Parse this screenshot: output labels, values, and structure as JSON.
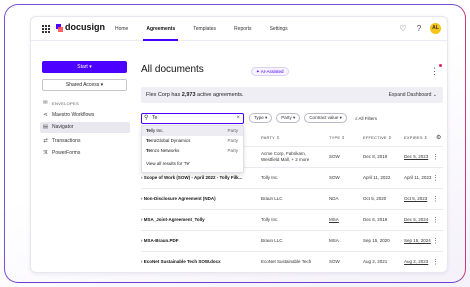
{
  "header": {
    "brand": "docusign",
    "nav": [
      "Home",
      "Agreements",
      "Templates",
      "Reports",
      "Settings"
    ],
    "active_nav": "Agreements",
    "avatar_initials": "AL"
  },
  "sidebar": {
    "start_label": "Start",
    "shared_access_label": "Shared Access",
    "items": [
      {
        "label": "ENVELOPES",
        "icon": "envelope-icon"
      },
      {
        "label": "Maestro Workflows",
        "icon": "workflow-icon"
      },
      {
        "label": "Navigator",
        "icon": "navigator-icon"
      },
      {
        "label": "Transactions",
        "icon": "transactions-icon"
      },
      {
        "label": "PowerForms",
        "icon": "powerforms-icon"
      }
    ]
  },
  "main": {
    "title": "All documents",
    "ai_badge": "AI-Assisted",
    "banner_prefix": "Flex Corp has ",
    "banner_count": "2,973",
    "banner_suffix": " active agreements.",
    "expand_label": "Expand Dashboard"
  },
  "search": {
    "value": "Te",
    "suggestions": [
      {
        "bold": "Te",
        "rest": "lly Inc.",
        "tag": "Party"
      },
      {
        "bold": "Te",
        "rest": "rraGlobal Dynamics",
        "tag": "Party"
      },
      {
        "bold": "Te",
        "rest": "Inzo Networks",
        "tag": "Party"
      }
    ],
    "view_all": "View all results for 'Te'"
  },
  "filters": [
    "Type",
    "Party",
    "Contract value"
  ],
  "all_filters_label": "All Filters",
  "table": {
    "headers": {
      "party": "PARTY",
      "type": "TYPE",
      "effective": "EFFECTIVE",
      "expires": "EXPIRES"
    },
    "rows": [
      {
        "name": "",
        "party": "Acme Corp, Fabrikam, Westfield Mall, + 2 more",
        "type": "SOW",
        "effective": "Dec 8, 2019",
        "expires": "Dec 5, 2023"
      },
      {
        "name": "Scope of Work (SOW) - April 2022 - Tolly Filk...",
        "party": "Tolly Inc.",
        "type": "SOW",
        "effective": "April 11, 2022",
        "expires": "April 11, 2023"
      },
      {
        "name": "Non-Disclosure Agreement (NDA)",
        "party": "Braun LLC",
        "type": "NDA",
        "effective": "Oct 5, 2020",
        "expires": "Oct 5, 2023"
      },
      {
        "name": "MSA_Joint-Agreement_Tolly",
        "party": "Tolly Inc.",
        "type": "MSA",
        "effective": "Dec 6, 2019",
        "expires": "Dec 5, 2024"
      },
      {
        "name": "MSA-Braun.PDF",
        "party": "Braun LLC",
        "type": "MSA",
        "effective": "Sep 15, 2020",
        "expires": "Sep 15, 2024"
      },
      {
        "name": "EcoNet Sustainable Tech SOW.docx",
        "party": "EcoNet Sustainable Tech",
        "type": "SOW",
        "effective": "Aug 2, 2021",
        "expires": "Aug 2, 2023"
      }
    ]
  }
}
